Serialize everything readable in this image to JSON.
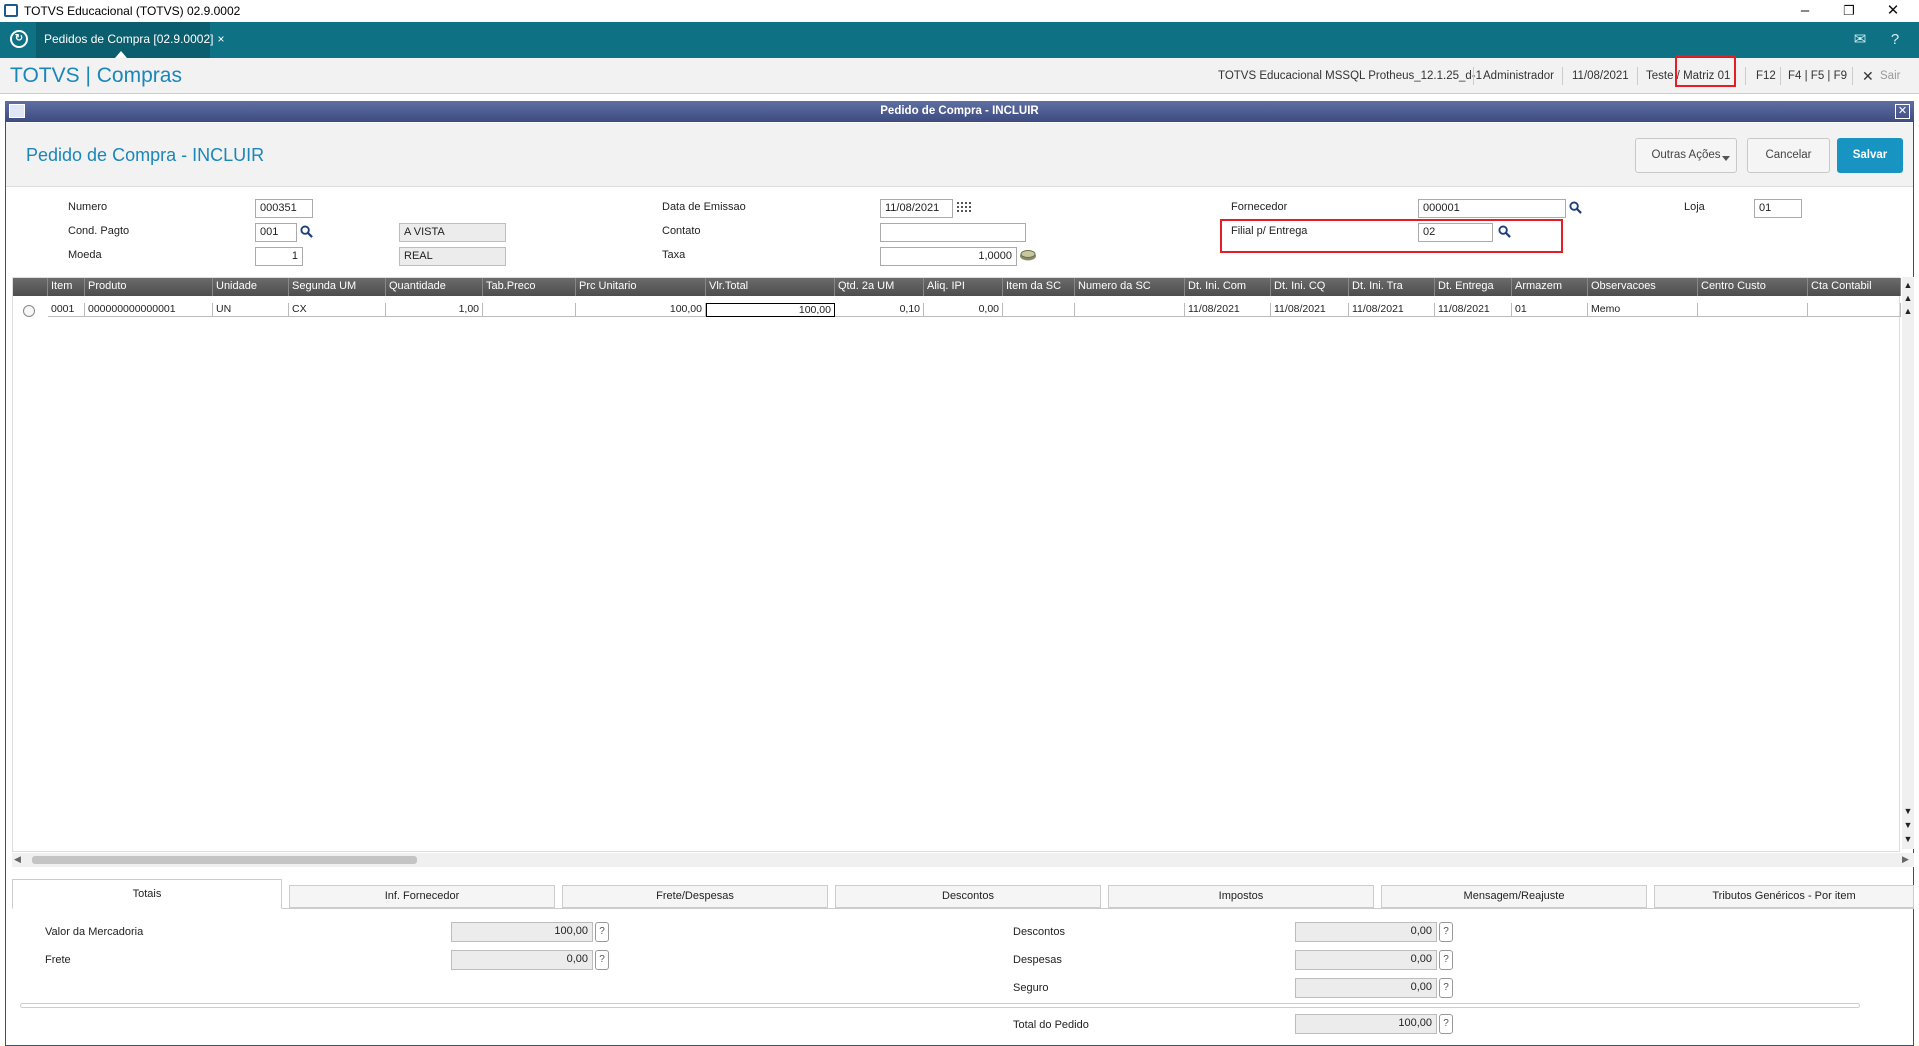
{
  "window": {
    "title": "TOTVS Educacional (TOTVS) 02.9.0002"
  },
  "tabbar": {
    "tab_label": "Pedidos de Compra [02.9.0002]",
    "tab_close": "×"
  },
  "header": {
    "brand": "TOTVS | Compras",
    "environment": "TOTVS Educacional MSSQL Protheus_12.1.25_d-1",
    "user": "Administrador",
    "date": "11/08/2021",
    "branch": "Teste / Matriz 01",
    "f12": "F12",
    "fkeys": "F4 | F5 | F9",
    "exit": "Sair"
  },
  "dialog": {
    "title": "Pedido de Compra - INCLUIR"
  },
  "form": {
    "title": "Pedido de Compra - INCLUIR",
    "buttons": {
      "other": "Outras Ações",
      "cancel": "Cancelar",
      "save": "Salvar"
    },
    "numero": {
      "label": "Numero",
      "value": "000351"
    },
    "cond_pagto": {
      "label": "Cond. Pagto",
      "value": "001",
      "desc": "A VISTA"
    },
    "moeda": {
      "label": "Moeda",
      "value": "1",
      "desc": "REAL"
    },
    "data_emissao": {
      "label": "Data de Emissao",
      "value": "11/08/2021"
    },
    "contato": {
      "label": "Contato",
      "value": ""
    },
    "taxa": {
      "label": "Taxa",
      "value": "1,0000"
    },
    "fornecedor": {
      "label": "Fornecedor",
      "value": "000001"
    },
    "filial_entrega": {
      "label": "Filial p/ Entrega",
      "value": "02"
    },
    "loja": {
      "label": "Loja",
      "value": "01"
    }
  },
  "grid": {
    "columns": [
      "Item",
      "Produto",
      "Unidade",
      "Segunda UM",
      "Quantidade",
      "Tab.Preco",
      "Prc Unitario",
      "Vlr.Total",
      "Qtd. 2a UM",
      "Aliq. IPI",
      "Item da SC",
      "Numero da SC",
      "Dt. Ini. Com",
      "Dt. Ini. CQ",
      "Dt. Ini. Tra",
      "Dt. Entrega",
      "Armazem",
      "Observacoes",
      "Centro Custo",
      "Cta Contabil"
    ],
    "rows": [
      [
        "0001",
        "000000000000001",
        "UN",
        "CX",
        "1,00",
        "",
        "100,00",
        "100,00",
        "0,10",
        "0,00",
        "",
        "",
        "11/08/2021",
        "11/08/2021",
        "11/08/2021",
        "11/08/2021",
        "01",
        "Memo",
        "",
        ""
      ]
    ]
  },
  "bottom_tabs": [
    "Totais",
    "Inf. Fornecedor",
    "Frete/Despesas",
    "Descontos",
    "Impostos",
    "Mensagem/Reajuste",
    "Tributos Genéricos - Por item"
  ],
  "totals": {
    "valor_mercadoria": {
      "label": "Valor da Mercadoria",
      "value": "100,00"
    },
    "frete": {
      "label": "Frete",
      "value": "0,00"
    },
    "descontos": {
      "label": "Descontos",
      "value": "0,00"
    },
    "despesas": {
      "label": "Despesas",
      "value": "0,00"
    },
    "seguro": {
      "label": "Seguro",
      "value": "0,00"
    },
    "total_pedido": {
      "label": "Total do Pedido",
      "value": "100,00"
    },
    "help": "?"
  }
}
